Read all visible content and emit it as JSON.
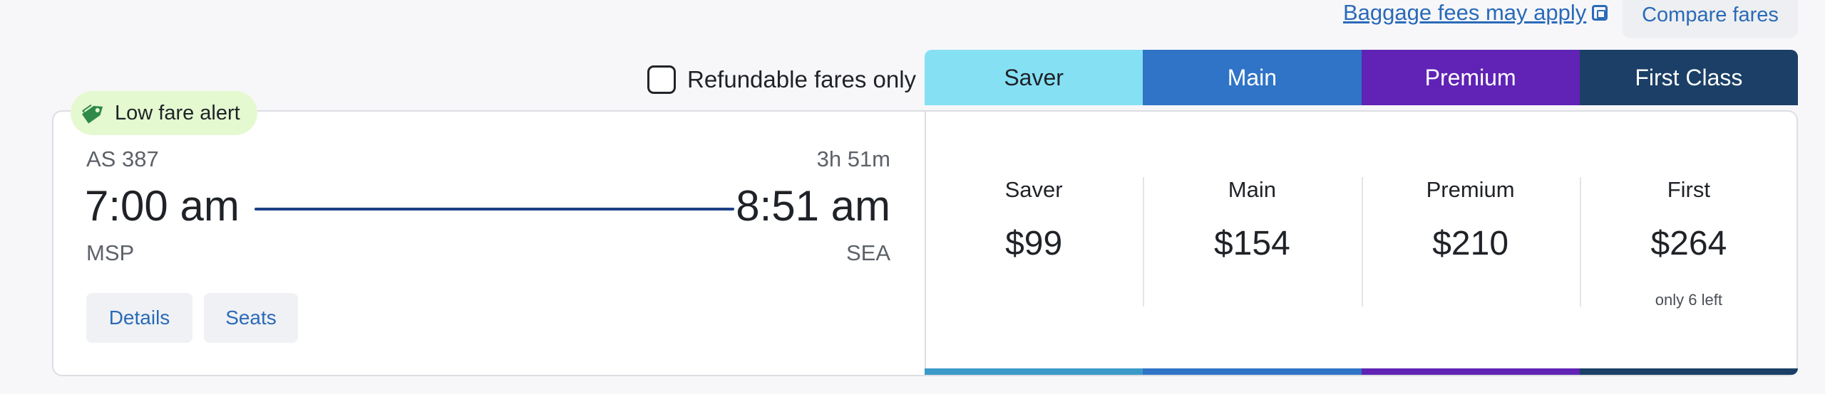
{
  "header": {
    "baggage_link": "Baggage fees may apply",
    "compare_label": "Compare fares"
  },
  "filter": {
    "refundable_label": "Refundable fares only",
    "refundable_checked": false
  },
  "tabs": [
    {
      "label": "Saver",
      "color": "#86e0f4",
      "text_color": "#1f2227"
    },
    {
      "label": "Main",
      "color": "#2f74c6",
      "text_color": "#ffffff"
    },
    {
      "label": "Premium",
      "color": "#6023b5",
      "text_color": "#ffffff"
    },
    {
      "label": "First Class",
      "color": "#1b3f66",
      "text_color": "#ffffff"
    }
  ],
  "flight": {
    "alert": "Low fare alert",
    "alert_icon": "tag-icon",
    "number": "AS 387",
    "duration": "3h 51m",
    "depart_time": "7:00 am",
    "arrive_time": "8:51 am",
    "origin": "MSP",
    "destination": "SEA",
    "details_label": "Details",
    "seats_label": "Seats"
  },
  "fares": [
    {
      "name": "Saver",
      "price": "$99",
      "note": "",
      "bar_color": "#3b9ac9"
    },
    {
      "name": "Main",
      "price": "$154",
      "note": "",
      "bar_color": "#2f74c6"
    },
    {
      "name": "Premium",
      "price": "$210",
      "note": "",
      "bar_color": "#6023b5"
    },
    {
      "name": "First",
      "price": "$264",
      "note": "only 6 left",
      "bar_color": "#1b3f66"
    }
  ]
}
